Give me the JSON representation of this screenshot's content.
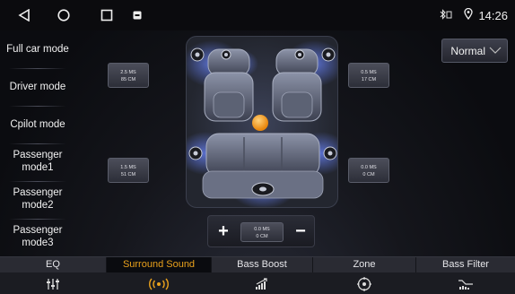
{
  "statusbar": {
    "time": "14:26"
  },
  "modes": [
    "Full car mode",
    "Driver mode",
    "Cpilot mode",
    "Passenger mode1",
    "Passenger mode2",
    "Passenger mode3"
  ],
  "delays": {
    "front_left": {
      "ms": "2.5 MS",
      "cm": "85 CM"
    },
    "front_right": {
      "ms": "0.5 MS",
      "cm": "17 CM"
    },
    "rear_left": {
      "ms": "1.5 MS",
      "cm": "51 CM"
    },
    "rear_right": {
      "ms": "0.0 MS",
      "cm": "0 CM"
    },
    "subwoofer": {
      "ms": "0.0 MS",
      "cm": "0 CM"
    }
  },
  "preset": {
    "label": "Normal"
  },
  "stepper": {
    "plus": "+",
    "minus": "−"
  },
  "tabs": [
    {
      "label": "EQ",
      "icon": "equalizer-icon"
    },
    {
      "label": "Surround Sound",
      "icon": "surround-icon"
    },
    {
      "label": "Bass Boost",
      "icon": "bass-boost-icon"
    },
    {
      "label": "Zone",
      "icon": "zone-icon"
    },
    {
      "label": "Bass Filter",
      "icon": "bass-filter-icon"
    }
  ],
  "colors": {
    "accent": "#e9a11c",
    "focus_dot": "#f0a020",
    "glow": "#5a7cff"
  }
}
